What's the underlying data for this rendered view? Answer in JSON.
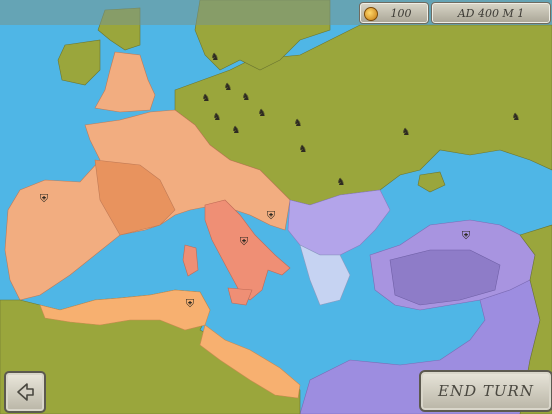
{
  "hud": {
    "gold": "100",
    "date": "AD 400 M 1"
  },
  "buttons": {
    "end_turn": "END TURN",
    "back_icon": "back-arrow-icon"
  },
  "colors": {
    "sea": "#4fb6e6",
    "barbarian_land": "#9aa63c",
    "western_empire": "#f2ad80",
    "eastern_empire": "#b3a4ea",
    "africa": "#f7b070",
    "italy": "#ef8f75"
  }
}
